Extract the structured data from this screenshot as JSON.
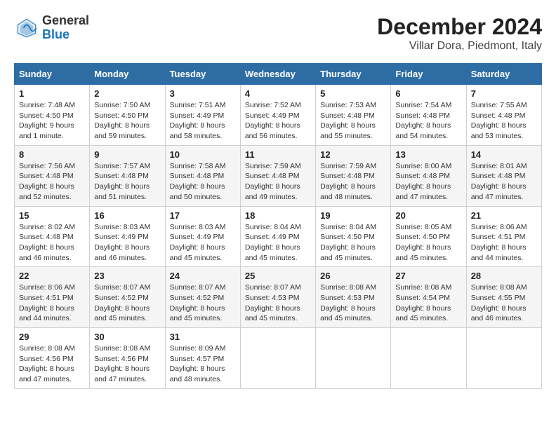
{
  "header": {
    "logo_general": "General",
    "logo_blue": "Blue",
    "month_title": "December 2024",
    "subtitle": "Villar Dora, Piedmont, Italy"
  },
  "days_of_week": [
    "Sunday",
    "Monday",
    "Tuesday",
    "Wednesday",
    "Thursday",
    "Friday",
    "Saturday"
  ],
  "weeks": [
    [
      {
        "day": "1",
        "sunrise": "Sunrise: 7:48 AM",
        "sunset": "Sunset: 4:50 PM",
        "daylight": "Daylight: 9 hours and 1 minute."
      },
      {
        "day": "2",
        "sunrise": "Sunrise: 7:50 AM",
        "sunset": "Sunset: 4:50 PM",
        "daylight": "Daylight: 8 hours and 59 minutes."
      },
      {
        "day": "3",
        "sunrise": "Sunrise: 7:51 AM",
        "sunset": "Sunset: 4:49 PM",
        "daylight": "Daylight: 8 hours and 58 minutes."
      },
      {
        "day": "4",
        "sunrise": "Sunrise: 7:52 AM",
        "sunset": "Sunset: 4:49 PM",
        "daylight": "Daylight: 8 hours and 56 minutes."
      },
      {
        "day": "5",
        "sunrise": "Sunrise: 7:53 AM",
        "sunset": "Sunset: 4:48 PM",
        "daylight": "Daylight: 8 hours and 55 minutes."
      },
      {
        "day": "6",
        "sunrise": "Sunrise: 7:54 AM",
        "sunset": "Sunset: 4:48 PM",
        "daylight": "Daylight: 8 hours and 54 minutes."
      },
      {
        "day": "7",
        "sunrise": "Sunrise: 7:55 AM",
        "sunset": "Sunset: 4:48 PM",
        "daylight": "Daylight: 8 hours and 53 minutes."
      }
    ],
    [
      {
        "day": "8",
        "sunrise": "Sunrise: 7:56 AM",
        "sunset": "Sunset: 4:48 PM",
        "daylight": "Daylight: 8 hours and 52 minutes."
      },
      {
        "day": "9",
        "sunrise": "Sunrise: 7:57 AM",
        "sunset": "Sunset: 4:48 PM",
        "daylight": "Daylight: 8 hours and 51 minutes."
      },
      {
        "day": "10",
        "sunrise": "Sunrise: 7:58 AM",
        "sunset": "Sunset: 4:48 PM",
        "daylight": "Daylight: 8 hours and 50 minutes."
      },
      {
        "day": "11",
        "sunrise": "Sunrise: 7:59 AM",
        "sunset": "Sunset: 4:48 PM",
        "daylight": "Daylight: 8 hours and 49 minutes."
      },
      {
        "day": "12",
        "sunrise": "Sunrise: 7:59 AM",
        "sunset": "Sunset: 4:48 PM",
        "daylight": "Daylight: 8 hours and 48 minutes."
      },
      {
        "day": "13",
        "sunrise": "Sunrise: 8:00 AM",
        "sunset": "Sunset: 4:48 PM",
        "daylight": "Daylight: 8 hours and 47 minutes."
      },
      {
        "day": "14",
        "sunrise": "Sunrise: 8:01 AM",
        "sunset": "Sunset: 4:48 PM",
        "daylight": "Daylight: 8 hours and 47 minutes."
      }
    ],
    [
      {
        "day": "15",
        "sunrise": "Sunrise: 8:02 AM",
        "sunset": "Sunset: 4:48 PM",
        "daylight": "Daylight: 8 hours and 46 minutes."
      },
      {
        "day": "16",
        "sunrise": "Sunrise: 8:03 AM",
        "sunset": "Sunset: 4:49 PM",
        "daylight": "Daylight: 8 hours and 46 minutes."
      },
      {
        "day": "17",
        "sunrise": "Sunrise: 8:03 AM",
        "sunset": "Sunset: 4:49 PM",
        "daylight": "Daylight: 8 hours and 45 minutes."
      },
      {
        "day": "18",
        "sunrise": "Sunrise: 8:04 AM",
        "sunset": "Sunset: 4:49 PM",
        "daylight": "Daylight: 8 hours and 45 minutes."
      },
      {
        "day": "19",
        "sunrise": "Sunrise: 8:04 AM",
        "sunset": "Sunset: 4:50 PM",
        "daylight": "Daylight: 8 hours and 45 minutes."
      },
      {
        "day": "20",
        "sunrise": "Sunrise: 8:05 AM",
        "sunset": "Sunset: 4:50 PM",
        "daylight": "Daylight: 8 hours and 45 minutes."
      },
      {
        "day": "21",
        "sunrise": "Sunrise: 8:06 AM",
        "sunset": "Sunset: 4:51 PM",
        "daylight": "Daylight: 8 hours and 44 minutes."
      }
    ],
    [
      {
        "day": "22",
        "sunrise": "Sunrise: 8:06 AM",
        "sunset": "Sunset: 4:51 PM",
        "daylight": "Daylight: 8 hours and 44 minutes."
      },
      {
        "day": "23",
        "sunrise": "Sunrise: 8:07 AM",
        "sunset": "Sunset: 4:52 PM",
        "daylight": "Daylight: 8 hours and 45 minutes."
      },
      {
        "day": "24",
        "sunrise": "Sunrise: 8:07 AM",
        "sunset": "Sunset: 4:52 PM",
        "daylight": "Daylight: 8 hours and 45 minutes."
      },
      {
        "day": "25",
        "sunrise": "Sunrise: 8:07 AM",
        "sunset": "Sunset: 4:53 PM",
        "daylight": "Daylight: 8 hours and 45 minutes."
      },
      {
        "day": "26",
        "sunrise": "Sunrise: 8:08 AM",
        "sunset": "Sunset: 4:53 PM",
        "daylight": "Daylight: 8 hours and 45 minutes."
      },
      {
        "day": "27",
        "sunrise": "Sunrise: 8:08 AM",
        "sunset": "Sunset: 4:54 PM",
        "daylight": "Daylight: 8 hours and 45 minutes."
      },
      {
        "day": "28",
        "sunrise": "Sunrise: 8:08 AM",
        "sunset": "Sunset: 4:55 PM",
        "daylight": "Daylight: 8 hours and 46 minutes."
      }
    ],
    [
      {
        "day": "29",
        "sunrise": "Sunrise: 8:08 AM",
        "sunset": "Sunset: 4:56 PM",
        "daylight": "Daylight: 8 hours and 47 minutes."
      },
      {
        "day": "30",
        "sunrise": "Sunrise: 8:08 AM",
        "sunset": "Sunset: 4:56 PM",
        "daylight": "Daylight: 8 hours and 47 minutes."
      },
      {
        "day": "31",
        "sunrise": "Sunrise: 8:09 AM",
        "sunset": "Sunset: 4:57 PM",
        "daylight": "Daylight: 8 hours and 48 minutes."
      },
      null,
      null,
      null,
      null
    ]
  ]
}
